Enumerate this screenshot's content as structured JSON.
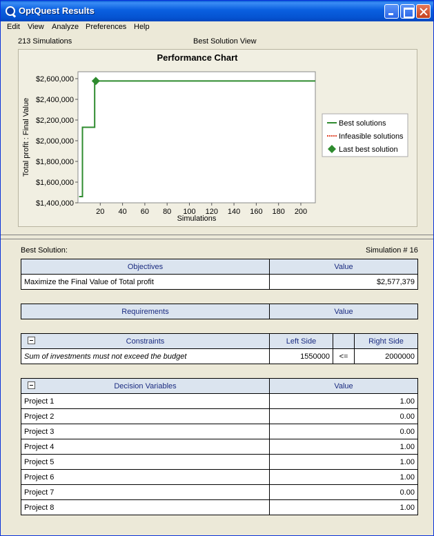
{
  "window": {
    "title": "OptQuest Results"
  },
  "menu": [
    "Edit",
    "View",
    "Analyze",
    "Preferences",
    "Help"
  ],
  "chart_header": {
    "simulations": "213 Simulations",
    "view": "Best Solution View"
  },
  "chart_data": {
    "type": "line",
    "title": "Performance Chart",
    "xlabel": "Simulations",
    "ylabel": "Total profit : Final Value",
    "xlim": [
      0,
      213
    ],
    "ylim": [
      1400000,
      2600000
    ],
    "xticks": [
      20,
      40,
      60,
      80,
      100,
      120,
      140,
      160,
      180,
      200
    ],
    "yticks": [
      1400000,
      1600000,
      1800000,
      2000000,
      2200000,
      2400000,
      2600000
    ],
    "ytick_labels": [
      "$1,400,000",
      "$1,600,000",
      "$1,800,000",
      "$2,000,000",
      "$2,200,000",
      "$2,400,000",
      "$2,600,000"
    ],
    "grid": false,
    "legend_placement": "right",
    "series": [
      {
        "name": "Best solutions",
        "color": "#2e8b2e",
        "style": "solid",
        "points": [
          [
            1,
            1460000
          ],
          [
            4,
            1460000
          ],
          [
            4,
            2130000
          ],
          [
            15,
            2130000
          ],
          [
            15,
            2577379
          ],
          [
            213,
            2577379
          ]
        ]
      },
      {
        "name": "Infeasible solutions",
        "color": "#e0452a",
        "style": "dotted",
        "points": []
      },
      {
        "name": "Last best solution",
        "color": "#2e8b2e",
        "style": "marker-diamond",
        "points": [
          [
            16,
            2577379
          ]
        ]
      }
    ]
  },
  "best_solution": {
    "label": "Best Solution:",
    "simulation": "Simulation # 16"
  },
  "objectives": {
    "headers": [
      "Objectives",
      "Value"
    ],
    "rows": [
      [
        "Maximize the Final Value of Total profit",
        "$2,577,379"
      ]
    ]
  },
  "requirements": {
    "headers": [
      "Requirements",
      "Value"
    ]
  },
  "constraints": {
    "headers": [
      "Constraints",
      "Left Side",
      "",
      "Right Side"
    ],
    "rows": [
      [
        "Sum of investments must not exceed the budget",
        "1550000",
        "<=",
        "2000000"
      ]
    ]
  },
  "decision_variables": {
    "headers": [
      "Decision Variables",
      "Value"
    ],
    "rows": [
      [
        "Project 1",
        "1.00"
      ],
      [
        "Project 2",
        "0.00"
      ],
      [
        "Project 3",
        "0.00"
      ],
      [
        "Project 4",
        "1.00"
      ],
      [
        "Project 5",
        "1.00"
      ],
      [
        "Project 6",
        "1.00"
      ],
      [
        "Project 7",
        "0.00"
      ],
      [
        "Project 8",
        "1.00"
      ]
    ]
  }
}
